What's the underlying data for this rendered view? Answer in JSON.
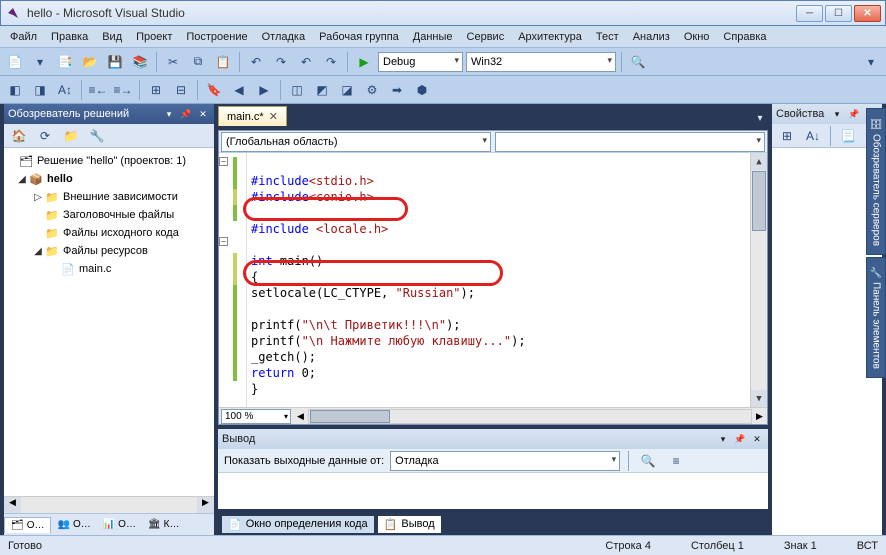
{
  "window": {
    "title": "hello - Microsoft Visual Studio"
  },
  "menu": [
    "Файл",
    "Правка",
    "Вид",
    "Проект",
    "Построение",
    "Отладка",
    "Рабочая группа",
    "Данные",
    "Сервис",
    "Архитектура",
    "Тест",
    "Анализ",
    "Окно",
    "Справка"
  ],
  "toolbar": {
    "config": "Debug",
    "platform": "Win32"
  },
  "solution": {
    "title": "Обозреватель решений",
    "root": "Решение \"hello\" (проектов: 1)",
    "project": "hello",
    "folders": [
      "Внешние зависимости",
      "Заголовочные файлы",
      "Файлы исходного кода",
      "Файлы ресурсов"
    ],
    "file": "main.c",
    "tabs": [
      "О…",
      "О…",
      "О…",
      "К…"
    ]
  },
  "doc": {
    "tab": "main.c*",
    "scope": "(Глобальная область)",
    "member": ""
  },
  "code": {
    "l1_k": "#include",
    "l1_v": "<stdio.h>",
    "l2_k": "#include",
    "l2_v": "<conio.h>",
    "l3_k": "#include",
    "l3_v": " <locale.h>",
    "l4_k": "int",
    "l4_v": " main()",
    "l5": "{",
    "l6a": "setlocale(LC_CTYPE, ",
    "l6b": "\"Russian\"",
    "l6c": ");",
    "l7a": "printf(",
    "l7b": "\"\\n\\t Приветик!!!\\n\"",
    "l7c": ");",
    "l8a": "printf(",
    "l8b": "\"\\n Нажмите любую клавишу...\"",
    "l8c": ");",
    "l9": "_getch();",
    "l10_k": "return",
    "l10_v": " 0;",
    "l11": "}"
  },
  "zoom": "100 %",
  "output": {
    "title": "Вывод",
    "label": "Показать выходные данные от:",
    "source": "Отладка",
    "tab1": "Окно определения кода",
    "tab2": "Вывод"
  },
  "props": {
    "title": "Свойства"
  },
  "vtabs": [
    "Обозреватель серверов",
    "Панель элементов"
  ],
  "status": {
    "ready": "Готово",
    "line": "Строка 4",
    "col": "Столбец 1",
    "char": "Знак 1",
    "ins": "ВСТ"
  }
}
